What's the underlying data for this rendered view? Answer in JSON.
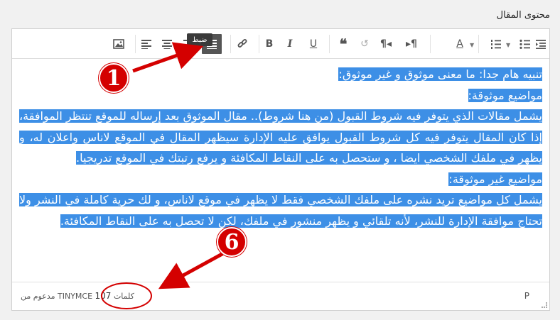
{
  "field_label": "محتوى المقال",
  "toolbar": {
    "tooltip": "ضبط"
  },
  "content": {
    "paragraphs": [
      "تنبيه هام جدا: ما معنى موثوق و غير موثوق:",
      "مواضيع موثوقة:",
      "يشمل مقالات الذي يتوفر فيه شروط القبول (من هنا شروط).. مقال الموثوق بعد إرساله للموقع تنتظر الموافقة، إذا كان المقال يتوفر فيه كل شروط القبول يوافق عليه الإدارة سيظهر المقال في الموقع لاناس واعلان له، و يظهر في ملفك الشخصي ايضا ، و ستحصل به على النقاط المكافئة و يرفع رتبتك في الموقع تدريجيا.",
      "مواضيع غير موثوقة:",
      "يشمل كل مواضيع تريد نشره على ملفك الشخصي فقط لا يظهر في موقع لاناس، و لك حرية كاملة في النشر ولا تحتاج موافقة الإدارة للنشر، لأنه تلقائي و يظهر منشور في ملفك، لكن لا تحصل به على النقاط المكافئة."
    ]
  },
  "statusbar": {
    "path": "P",
    "word_count": "107",
    "word_label": "كلمات",
    "powered_by": "مدعوم من TINYMCE"
  },
  "annotations": {
    "badge_1": "1",
    "badge_6": "6",
    "color": "#d40000"
  }
}
